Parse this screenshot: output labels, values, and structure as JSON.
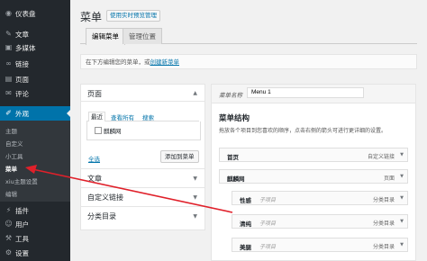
{
  "sidebar": {
    "items": [
      {
        "label": "仪表盘",
        "icon": "dashboard-icon",
        "glyph": "◉"
      },
      {
        "label": "文章",
        "icon": "pin-icon",
        "glyph": "✎"
      },
      {
        "label": "多媒体",
        "icon": "media-icon",
        "glyph": "▣"
      },
      {
        "label": "链接",
        "icon": "link-icon",
        "glyph": "∞"
      },
      {
        "label": "页面",
        "icon": "page-icon",
        "glyph": "▤"
      },
      {
        "label": "评论",
        "icon": "comment-icon",
        "glyph": "✉"
      },
      {
        "label": "外观",
        "icon": "appearance-icon",
        "glyph": "✐"
      },
      {
        "label": "插件",
        "icon": "plugin-icon",
        "glyph": "⚡"
      },
      {
        "label": "用户",
        "icon": "users-icon",
        "glyph": "☺"
      },
      {
        "label": "工具",
        "icon": "tools-icon",
        "glyph": "⚒"
      },
      {
        "label": "设置",
        "icon": "settings-icon",
        "glyph": "⚙"
      }
    ],
    "submenu": [
      "主题",
      "自定义",
      "小工具",
      "菜单",
      "xiu主题设置",
      "编辑"
    ]
  },
  "header": {
    "title": "菜单",
    "live_button": "使用实时预览管理"
  },
  "tabs": [
    "编辑菜单",
    "管理位置"
  ],
  "notice": {
    "text": "在下方编辑您的菜单，或",
    "link": "创建新菜单"
  },
  "left_panel": {
    "pages_title": "页面",
    "subtabs": [
      "最近",
      "查看所有",
      "搜索"
    ],
    "checkbox_label": "麒麟网",
    "select_all": "全选",
    "add_button": "添加到菜单",
    "sections": [
      "文章",
      "自定义链接",
      "分类目录"
    ]
  },
  "right_panel": {
    "menu_name_label": "菜单名称",
    "menu_name_value": "Menu 1",
    "structure_title": "菜单结构",
    "structure_desc": "拖放各个项目到您喜欢的顺序，点击右侧的箭头可进行更详细的设置。",
    "items": [
      {
        "name": "首页",
        "sub": "",
        "type": "自定义链接"
      },
      {
        "name": "麒麟网",
        "sub": "",
        "type": "页面"
      },
      {
        "name": "性感",
        "sub": "子项目",
        "type": "分类目录"
      },
      {
        "name": "清纯",
        "sub": "子项目",
        "type": "分类目录"
      },
      {
        "name": "美腿",
        "sub": "子项目",
        "type": "分类目录"
      }
    ]
  },
  "colors": {
    "sidebar_bg": "#23282d",
    "active": "#0073aa",
    "annotation_arrow": "#e0202a"
  }
}
